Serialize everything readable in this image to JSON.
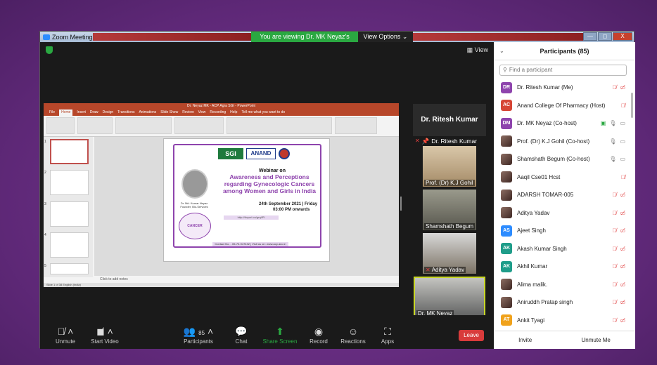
{
  "window": {
    "title": "Zoom Meeting",
    "banner": "You are viewing Dr. MK Neyaz's screen",
    "view_options": "View Options ⌄",
    "controls": [
      "—",
      "◻",
      "X"
    ]
  },
  "stage": {
    "view_label": "View"
  },
  "powerpoint": {
    "title": "Dr. Neyaz MK - ACP Agra SGI - PowerPoint",
    "menu": [
      "File",
      "Home",
      "Insert",
      "Draw",
      "Design",
      "Transitions",
      "Animations",
      "Slide Show",
      "Review",
      "View",
      "Recording",
      "Help",
      "Tell me what you want to do"
    ],
    "thumb_numbers": [
      "1",
      "2",
      "3",
      "4",
      "5"
    ],
    "notes_placeholder": "Click to add notes",
    "status": "Slide 1 of 38   English (India)"
  },
  "slide": {
    "logo_sgi": "SGI",
    "logo_anand": "ANAND",
    "webinar": "Webinar on",
    "headline": "Awareness and Perceptions regarding Gynecologic Cancers among Women and Girls in India",
    "date": "24th September 2021 | Friday",
    "time": "03:00 PM onwards",
    "founder": "Dr. Md. Kumar Neyaz Founder, Bio-Services",
    "cancer_label": "CANCER",
    "link": "http://tinyurl.co/grq4Pl",
    "contact": "Contact No. - 05-70-947432 | Visit us on: www.acp.anc.in"
  },
  "tiles": {
    "active_speaker": "Dr. Ritesh Kumar",
    "first_label": "Dr. Ritesh Kumar",
    "videos": [
      {
        "name": "Prof. (Dr) K.J Gohil"
      },
      {
        "name": "Shamshath Begum"
      },
      {
        "name": "Aditya Yadav"
      },
      {
        "name": "Dr. MK Neyaz"
      }
    ]
  },
  "toolbar": {
    "unmute": "Unmute",
    "start_video": "Start Video",
    "participants": "Participants",
    "participant_count": "85",
    "chat": "Chat",
    "share_screen": "Share Screen",
    "record": "Record",
    "reactions": "Reactions",
    "apps": "Apps",
    "leave": "Leave"
  },
  "panel": {
    "title": "Participants (85)",
    "search_placeholder": "Find a participant",
    "invite": "Invite",
    "unmute_me": "Unmute Me",
    "participants": [
      {
        "initials": "DR",
        "name": "Dr. Ritesh Kumar (Me)",
        "color": "#8e44ad",
        "icons": "mv"
      },
      {
        "initials": "AC",
        "name": "Anand College Of Pharmacy (Host)",
        "color": "#d64535",
        "icons": "m"
      },
      {
        "initials": "DM",
        "name": "Dr. MK Neyaz (Co-host)",
        "color": "#8e44ad",
        "icons": "share"
      },
      {
        "initials": "",
        "name": "Prof. (Dr) K.J Gohil (Co-host)",
        "color": "",
        "icons": "ok"
      },
      {
        "initials": "",
        "name": "Shamshath Begum (Co-host)",
        "color": "",
        "icons": "ok"
      },
      {
        "initials": "",
        "name": "Aaqil Cse01 Hcst",
        "color": "",
        "icons": "m"
      },
      {
        "initials": "",
        "name": "ADARSH TOMAR-005",
        "color": "",
        "icons": "mv"
      },
      {
        "initials": "",
        "name": "Aditya Yadav",
        "color": "",
        "icons": "mv"
      },
      {
        "initials": "AS",
        "name": "Ajeet Singh",
        "color": "#2d8cff",
        "icons": "mv"
      },
      {
        "initials": "AK",
        "name": "Akash Kumar Singh",
        "color": "#1f9d8a",
        "icons": "mv"
      },
      {
        "initials": "AK",
        "name": "Akhil Kumar",
        "color": "#1f9d8a",
        "icons": "mv"
      },
      {
        "initials": "",
        "name": "Alima malik.",
        "color": "",
        "icons": "mv"
      },
      {
        "initials": "",
        "name": "Aniruddh Pratap singh",
        "color": "",
        "icons": "mv"
      },
      {
        "initials": "AT",
        "name": "Ankit Tyagi",
        "color": "#f0a21c",
        "icons": "mv"
      }
    ]
  }
}
